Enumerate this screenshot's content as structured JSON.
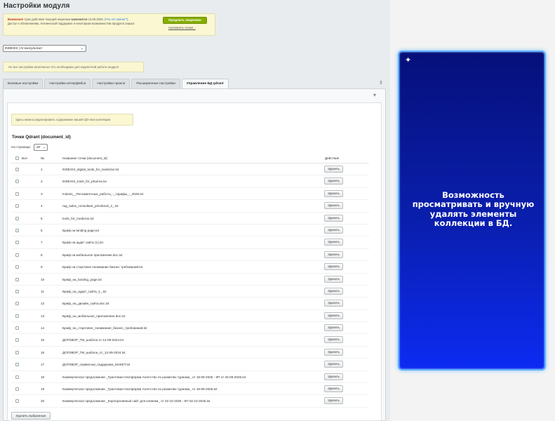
{
  "header": {
    "title": "Настройки модуля"
  },
  "notice": {
    "warn": "Внимание!",
    "text1": "Срок действия текущей лицензии",
    "strong": "закончится",
    "date": "13.09.2025.",
    "link": "(Что это значит?)",
    "text2": "Доступ к обновлениям, технической поддержке и некоторым возможностям продукта закрыт.",
    "button": "Продлить лицензию",
    "remind": "Напомнить позже..."
  },
  "module_select": {
    "value": "INDEXIS | AI-консультант"
  },
  "warning": "Не все настройки заполнены! Это необходимо для корректной работы модуля",
  "tabs": [
    {
      "label": "Базовые настройки"
    },
    {
      "label": "Настройки интерфейса"
    },
    {
      "label": "Настройки прокси"
    },
    {
      "label": "Расширенные настройки"
    },
    {
      "label": "Управление БД qdrant",
      "active": true
    }
  ],
  "info": "Здесь можно редактировать содержимое вашей QD-rant коллекции",
  "section": {
    "title": "Точки Qdrant (document_id)",
    "per_page_label": "На странице:",
    "per_page": "20"
  },
  "table": {
    "headers": {
      "all": "Все",
      "num": "№",
      "name": "Название точки (document_id)",
      "actions": "Действия"
    },
    "delete_label": "Удалить",
    "rows": [
      {
        "num": "1",
        "name": "INDEXIS_digital_tools_for_medicine.txt"
      },
      {
        "num": "2",
        "name": "INDEXIS_tools_for_pharma.txt"
      },
      {
        "num": "3",
        "name": "Indexis__Регламентные_работы_-_тарифы_-_2026.txt"
      },
      {
        "num": "4",
        "name": "rag_sales_consultant_pricebook_2_.txt"
      },
      {
        "num": "5",
        "name": "tools_for_medicine.txt"
      },
      {
        "num": "6",
        "name": "Бриф на landing page.txt"
      },
      {
        "num": "7",
        "name": "Бриф на аудит сайта (1).txt"
      },
      {
        "num": "8",
        "name": "Бриф на мобильное приложение.doc.txt"
      },
      {
        "num": "9",
        "name": "Бриф на стартовое понимание бизнес требований.txt"
      },
      {
        "num": "10",
        "name": "Бриф_на_landing_page.txt"
      },
      {
        "num": "11",
        "name": "Бриф_на_аудит_сайта_1_.txt"
      },
      {
        "num": "12",
        "name": "Бриф_на_дизайн_сайта.doc.txt"
      },
      {
        "num": "13",
        "name": "Бриф_на_мобильное_приложение.doc.txt"
      },
      {
        "num": "14",
        "name": "Бриф_на_стартовое_понимание_бизнес_требований.txt"
      },
      {
        "num": "15",
        "name": "ДОГОВОР_ТМ_шаблон от 12-09-2024.txt"
      },
      {
        "num": "16",
        "name": "ДОГОВОР_ТМ_шаблон_от_12-09-2024.txt"
      },
      {
        "num": "17",
        "name": "ДОГОВОР_сервисная_поддержка_МАКЕТ.txt"
      },
      {
        "num": "18",
        "name": "Коммерческое предложение _Грантовая платформа Агентство по развитию туризма_ от 18-09-2025 - КП от 25-09-2025.txt"
      },
      {
        "num": "19",
        "name": "Коммерческое предложение _Грантовая платформа Агентство по развитию туризма_ от 18-09-2025.txt"
      },
      {
        "num": "20",
        "name": "Коммерческое предложение _Корпоративный сайт для клиники_ от 02-10-2025 - КП 02-10-2025.txt"
      }
    ],
    "delete_selected": "Удалить выбранные"
  },
  "feature": {
    "text": "Возможность просматривать и вручную удалять элементы коллекции в БД."
  },
  "colors": {
    "card_top": "#06107a",
    "card_bottom": "#0c2bf2",
    "card_border": "#5fb0ff",
    "accent_green": "#86ad00"
  },
  "icons": {
    "star": "star-icon",
    "pin": "pin-icon",
    "collapse": "chevron-down-icon",
    "sparkle": "sparkle-icon"
  }
}
